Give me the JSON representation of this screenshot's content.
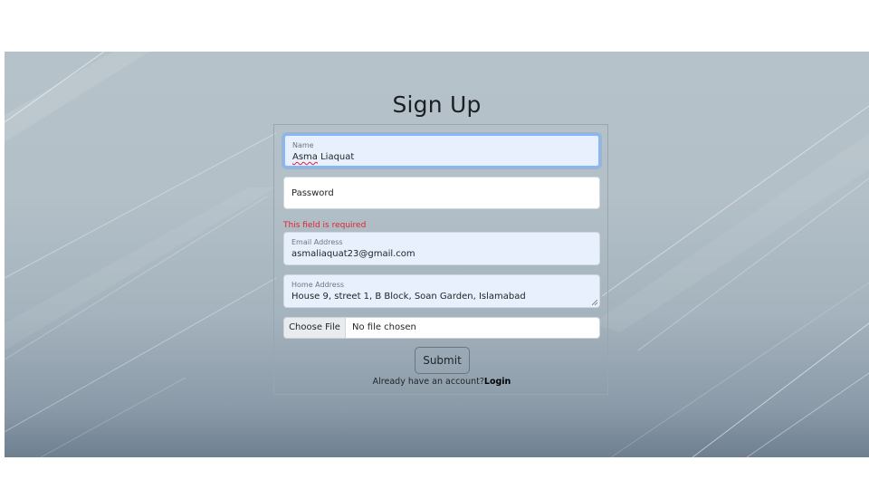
{
  "page": {
    "title": "Sign Up"
  },
  "form": {
    "name": {
      "label": "Name",
      "value_first": "Asma",
      "value_rest": " Liaquat"
    },
    "password": {
      "placeholder": "Password"
    },
    "error_text": "This field is required",
    "email": {
      "label": "Email Address",
      "value": "asmaliaquat23@gmail.com"
    },
    "home_address": {
      "label": "Home Address",
      "value": "House 9, street 1, B Block, Soan Garden, Islamabad"
    },
    "file": {
      "button_label": "Choose File",
      "status": "No file chosen"
    },
    "submit_label": "Submit",
    "footer": {
      "prompt": "Already have an account?",
      "login_link": "Login"
    }
  },
  "colors": {
    "error": "#e0242b",
    "autofill_bg": "#e8f0fe",
    "focus_ring": "#86b7fe"
  }
}
